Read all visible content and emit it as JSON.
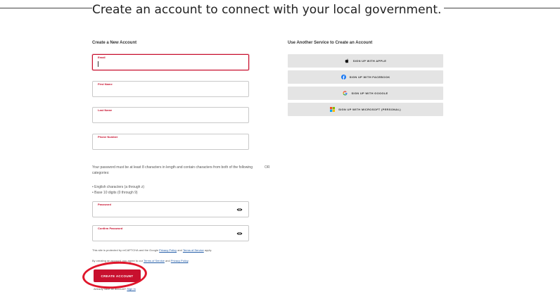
{
  "page": {
    "headline": "Create an account to connect with your local government."
  },
  "create_account": {
    "section_title": "Create a New Account",
    "fields": {
      "email": {
        "label": "Email",
        "value": ""
      },
      "first_name": {
        "label": "First Name",
        "value": ""
      },
      "last_name": {
        "label": "Last Name",
        "value": ""
      },
      "phone": {
        "label": "Phone Number",
        "value": ""
      },
      "password": {
        "label": "Password",
        "value": ""
      },
      "confirm_password": {
        "label": "Confirm Password",
        "value": ""
      }
    },
    "password_requirements": {
      "intro": "Your password must be at least 8 characters in length and contain characters from both of the following categories:",
      "items": [
        "English characters (a through z)",
        "Base 10 digits (0 through 9)"
      ]
    },
    "recaptcha": {
      "prefix": "This site is protected by reCAPTCHA and the Google",
      "privacy_link": "Privacy Policy",
      "and": "and",
      "terms_link": "Terms of Service",
      "suffix": "apply."
    },
    "agreement": {
      "prefix": "By creating an account, you agree to our",
      "terms_link": "Terms of Service",
      "and": "and",
      "privacy_link": "Privacy Policy",
      "suffix": "."
    },
    "submit_label": "CREATE ACCOUNT",
    "signin": {
      "prefix": "Already have an account?",
      "link": "Sign In"
    }
  },
  "divider": {
    "or_text": "OR"
  },
  "services": {
    "section_title": "Use Another Service to Create an Account",
    "buttons": [
      {
        "label": "SIGN UP WITH APPLE",
        "icon": "apple-icon"
      },
      {
        "label": "SIGN UP WITH FACEBOOK",
        "icon": "facebook-icon"
      },
      {
        "label": "SIGN UP WITH GOOGLE",
        "icon": "google-icon"
      },
      {
        "label": "SIGN UP WITH MICROSOFT (PERSONAL)",
        "icon": "microsoft-icon"
      }
    ]
  },
  "colors": {
    "accent": "#c8102e",
    "service_button_bg": "#e4e4e4",
    "link": "#1f5aa6",
    "annotation_ring": "#e0162b"
  }
}
